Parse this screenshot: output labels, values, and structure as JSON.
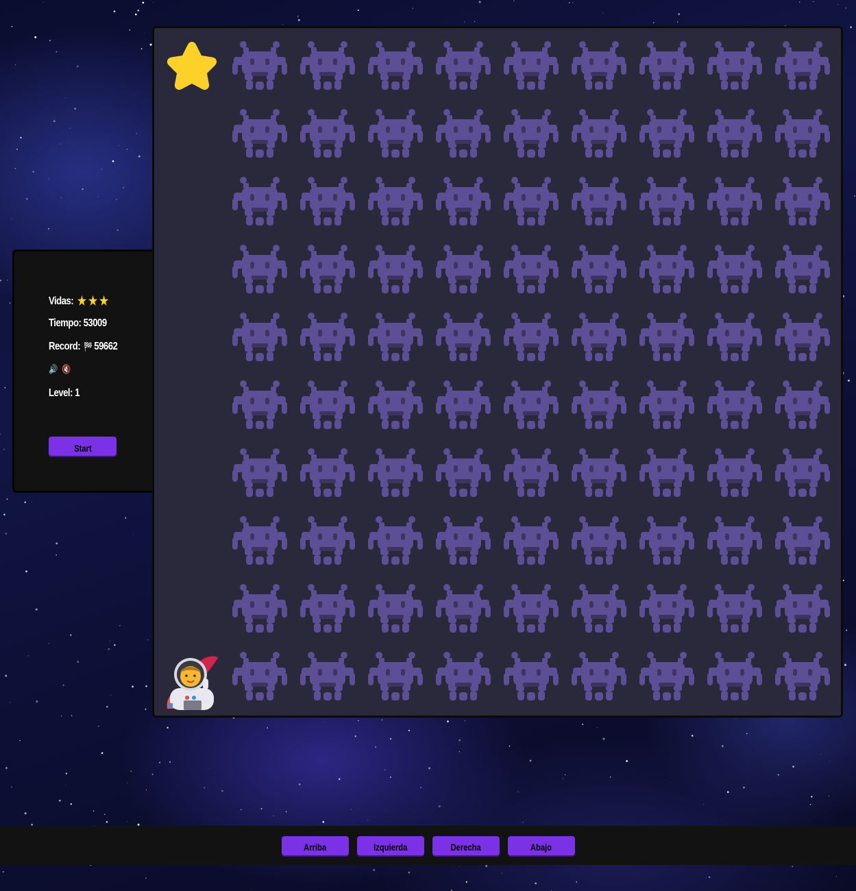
{
  "stats": {
    "lives_label": "Vidas:",
    "lives": [
      "★",
      "★",
      "★"
    ],
    "time_label": "Tiempo:",
    "time_value": "53009",
    "record_label": "Record:",
    "record_icon": "🏁",
    "record_value": "59662",
    "sound_on_icon": "🔊",
    "sound_off_icon": "🔇",
    "level_label": "Level:",
    "level_value": "1",
    "start_label": "Start"
  },
  "board": {
    "rows": 10,
    "cols": 10,
    "goal_icon": "star-icon",
    "player_icon": "astronaut-icon",
    "obstacle_icon": "alien-invader-icon",
    "cells": [
      [
        "goal",
        "enemy",
        "enemy",
        "enemy",
        "enemy",
        "enemy",
        "enemy",
        "enemy",
        "enemy",
        "enemy"
      ],
      [
        "empty",
        "enemy",
        "enemy",
        "enemy",
        "enemy",
        "enemy",
        "enemy",
        "enemy",
        "enemy",
        "enemy"
      ],
      [
        "empty",
        "enemy",
        "enemy",
        "enemy",
        "enemy",
        "enemy",
        "enemy",
        "enemy",
        "enemy",
        "enemy"
      ],
      [
        "empty",
        "enemy",
        "enemy",
        "enemy",
        "enemy",
        "enemy",
        "enemy",
        "enemy",
        "enemy",
        "enemy"
      ],
      [
        "empty",
        "enemy",
        "enemy",
        "enemy",
        "enemy",
        "enemy",
        "enemy",
        "enemy",
        "enemy",
        "enemy"
      ],
      [
        "empty",
        "enemy",
        "enemy",
        "enemy",
        "enemy",
        "enemy",
        "enemy",
        "enemy",
        "enemy",
        "enemy"
      ],
      [
        "empty",
        "enemy",
        "enemy",
        "enemy",
        "enemy",
        "enemy",
        "enemy",
        "enemy",
        "enemy",
        "enemy"
      ],
      [
        "empty",
        "enemy",
        "enemy",
        "enemy",
        "enemy",
        "enemy",
        "enemy",
        "enemy",
        "enemy",
        "enemy"
      ],
      [
        "empty",
        "enemy",
        "enemy",
        "enemy",
        "enemy",
        "enemy",
        "enemy",
        "enemy",
        "enemy",
        "enemy"
      ],
      [
        "player",
        "enemy",
        "enemy",
        "enemy",
        "enemy",
        "enemy",
        "enemy",
        "enemy",
        "enemy",
        "enemy"
      ]
    ]
  },
  "controls": {
    "up_label": "Arriba",
    "left_label": "Izquierda",
    "right_label": "Derecha",
    "down_label": "Abajo"
  },
  "colors": {
    "accent": "#7b31e6",
    "board_bg": "#2a283b",
    "enemy": "#5c4f96",
    "star": "#fcd12a",
    "panel_bg": "#121212"
  }
}
